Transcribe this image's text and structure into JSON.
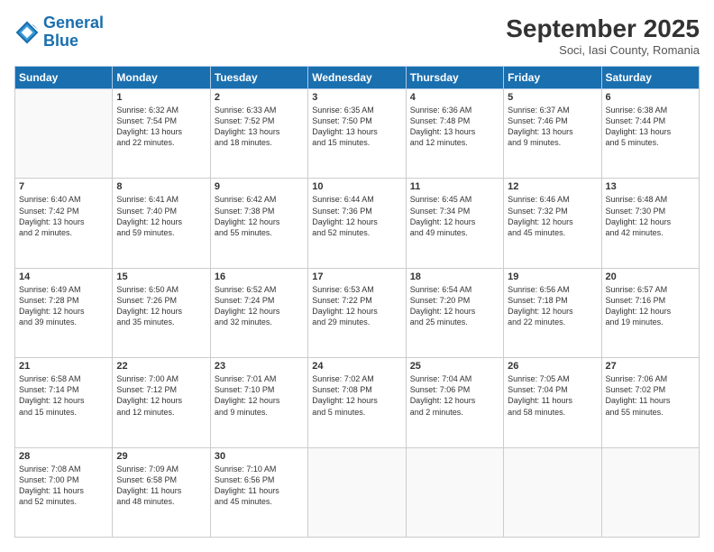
{
  "header": {
    "logo_line1": "General",
    "logo_line2": "Blue",
    "month": "September 2025",
    "location": "Soci, Iasi County, Romania"
  },
  "weekdays": [
    "Sunday",
    "Monday",
    "Tuesday",
    "Wednesday",
    "Thursday",
    "Friday",
    "Saturday"
  ],
  "weeks": [
    [
      {
        "day": "",
        "text": ""
      },
      {
        "day": "1",
        "text": "Sunrise: 6:32 AM\nSunset: 7:54 PM\nDaylight: 13 hours\nand 22 minutes."
      },
      {
        "day": "2",
        "text": "Sunrise: 6:33 AM\nSunset: 7:52 PM\nDaylight: 13 hours\nand 18 minutes."
      },
      {
        "day": "3",
        "text": "Sunrise: 6:35 AM\nSunset: 7:50 PM\nDaylight: 13 hours\nand 15 minutes."
      },
      {
        "day": "4",
        "text": "Sunrise: 6:36 AM\nSunset: 7:48 PM\nDaylight: 13 hours\nand 12 minutes."
      },
      {
        "day": "5",
        "text": "Sunrise: 6:37 AM\nSunset: 7:46 PM\nDaylight: 13 hours\nand 9 minutes."
      },
      {
        "day": "6",
        "text": "Sunrise: 6:38 AM\nSunset: 7:44 PM\nDaylight: 13 hours\nand 5 minutes."
      }
    ],
    [
      {
        "day": "7",
        "text": "Sunrise: 6:40 AM\nSunset: 7:42 PM\nDaylight: 13 hours\nand 2 minutes."
      },
      {
        "day": "8",
        "text": "Sunrise: 6:41 AM\nSunset: 7:40 PM\nDaylight: 12 hours\nand 59 minutes."
      },
      {
        "day": "9",
        "text": "Sunrise: 6:42 AM\nSunset: 7:38 PM\nDaylight: 12 hours\nand 55 minutes."
      },
      {
        "day": "10",
        "text": "Sunrise: 6:44 AM\nSunset: 7:36 PM\nDaylight: 12 hours\nand 52 minutes."
      },
      {
        "day": "11",
        "text": "Sunrise: 6:45 AM\nSunset: 7:34 PM\nDaylight: 12 hours\nand 49 minutes."
      },
      {
        "day": "12",
        "text": "Sunrise: 6:46 AM\nSunset: 7:32 PM\nDaylight: 12 hours\nand 45 minutes."
      },
      {
        "day": "13",
        "text": "Sunrise: 6:48 AM\nSunset: 7:30 PM\nDaylight: 12 hours\nand 42 minutes."
      }
    ],
    [
      {
        "day": "14",
        "text": "Sunrise: 6:49 AM\nSunset: 7:28 PM\nDaylight: 12 hours\nand 39 minutes."
      },
      {
        "day": "15",
        "text": "Sunrise: 6:50 AM\nSunset: 7:26 PM\nDaylight: 12 hours\nand 35 minutes."
      },
      {
        "day": "16",
        "text": "Sunrise: 6:52 AM\nSunset: 7:24 PM\nDaylight: 12 hours\nand 32 minutes."
      },
      {
        "day": "17",
        "text": "Sunrise: 6:53 AM\nSunset: 7:22 PM\nDaylight: 12 hours\nand 29 minutes."
      },
      {
        "day": "18",
        "text": "Sunrise: 6:54 AM\nSunset: 7:20 PM\nDaylight: 12 hours\nand 25 minutes."
      },
      {
        "day": "19",
        "text": "Sunrise: 6:56 AM\nSunset: 7:18 PM\nDaylight: 12 hours\nand 22 minutes."
      },
      {
        "day": "20",
        "text": "Sunrise: 6:57 AM\nSunset: 7:16 PM\nDaylight: 12 hours\nand 19 minutes."
      }
    ],
    [
      {
        "day": "21",
        "text": "Sunrise: 6:58 AM\nSunset: 7:14 PM\nDaylight: 12 hours\nand 15 minutes."
      },
      {
        "day": "22",
        "text": "Sunrise: 7:00 AM\nSunset: 7:12 PM\nDaylight: 12 hours\nand 12 minutes."
      },
      {
        "day": "23",
        "text": "Sunrise: 7:01 AM\nSunset: 7:10 PM\nDaylight: 12 hours\nand 9 minutes."
      },
      {
        "day": "24",
        "text": "Sunrise: 7:02 AM\nSunset: 7:08 PM\nDaylight: 12 hours\nand 5 minutes."
      },
      {
        "day": "25",
        "text": "Sunrise: 7:04 AM\nSunset: 7:06 PM\nDaylight: 12 hours\nand 2 minutes."
      },
      {
        "day": "26",
        "text": "Sunrise: 7:05 AM\nSunset: 7:04 PM\nDaylight: 11 hours\nand 58 minutes."
      },
      {
        "day": "27",
        "text": "Sunrise: 7:06 AM\nSunset: 7:02 PM\nDaylight: 11 hours\nand 55 minutes."
      }
    ],
    [
      {
        "day": "28",
        "text": "Sunrise: 7:08 AM\nSunset: 7:00 PM\nDaylight: 11 hours\nand 52 minutes."
      },
      {
        "day": "29",
        "text": "Sunrise: 7:09 AM\nSunset: 6:58 PM\nDaylight: 11 hours\nand 48 minutes."
      },
      {
        "day": "30",
        "text": "Sunrise: 7:10 AM\nSunset: 6:56 PM\nDaylight: 11 hours\nand 45 minutes."
      },
      {
        "day": "",
        "text": ""
      },
      {
        "day": "",
        "text": ""
      },
      {
        "day": "",
        "text": ""
      },
      {
        "day": "",
        "text": ""
      }
    ]
  ]
}
